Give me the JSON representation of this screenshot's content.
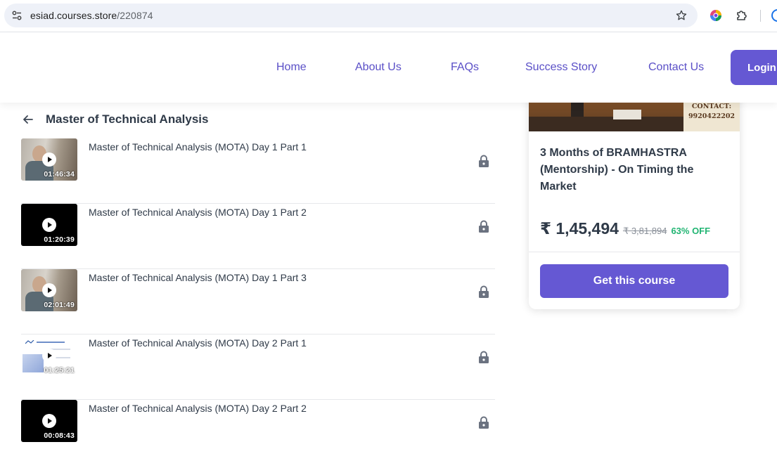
{
  "browser": {
    "url_host": "esiad.courses.store",
    "url_path": "/220874"
  },
  "nav": {
    "home": "Home",
    "about": "About Us",
    "faqs": "FAQs",
    "success_story": "Success Story",
    "contact": "Contact Us",
    "login": "Login"
  },
  "section": {
    "title": "Master of Technical Analysis"
  },
  "lessons": [
    {
      "title": "Master of Technical Analysis (MOTA) Day 1 Part 1",
      "duration": "01:46:34",
      "thumb": "person",
      "locked": true
    },
    {
      "title": "Master of Technical Analysis (MOTA) Day 1 Part 2",
      "duration": "01:20:39",
      "thumb": "black",
      "locked": true
    },
    {
      "title": "Master of Technical Analysis (MOTA) Day 1 Part 3",
      "duration": "02:01:49",
      "thumb": "person",
      "locked": true
    },
    {
      "title": "Master of Technical Analysis (MOTA) Day 2 Part 1",
      "duration": "01:25:21",
      "thumb": "slide",
      "locked": true
    },
    {
      "title": "Master of Technical Analysis (MOTA) Day 2 Part 2",
      "duration": "00:08:43",
      "thumb": "black",
      "locked": true
    }
  ],
  "course_card": {
    "image_contact_label": "CONTACT:",
    "image_contact_number": "9920422202",
    "title": "3 Months of BRAMHASTRA (Mentorship) - On Timing the Market",
    "price": "₹ 1,45,494",
    "mrp": "₹ 3,81,894",
    "discount": "63% OFF",
    "cta": "Get this course"
  },
  "colors": {
    "brand": "#6558d3",
    "nav_text": "#5a4fc7",
    "discount": "#22b573",
    "text": "#2f3a48"
  },
  "icons": [
    "tune-icon",
    "star-icon",
    "extension-color-icon",
    "puzzle-icon",
    "profile-icon",
    "back-arrow-icon",
    "play-icon",
    "lock-icon"
  ]
}
